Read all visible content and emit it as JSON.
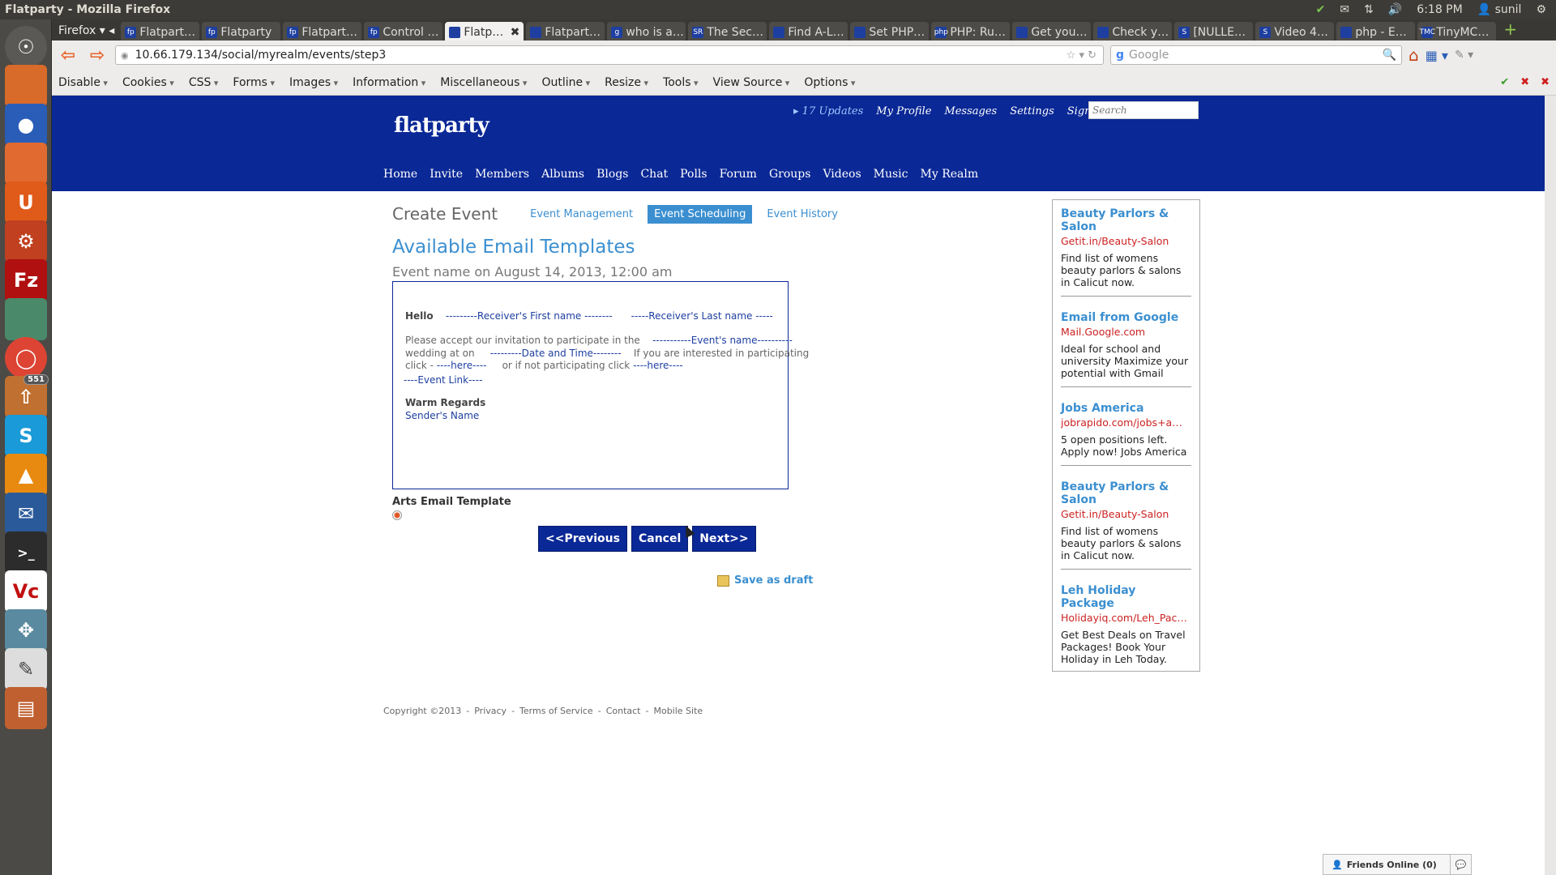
{
  "os": {
    "window_title": "Flatparty - Mozilla Firefox",
    "time": "6:18 PM",
    "user": "sunil",
    "launcher_badge": "551"
  },
  "browser": {
    "menu_label": "Firefox",
    "tabs": [
      {
        "label": "Flatpart…",
        "fav": "fp"
      },
      {
        "label": "Flatparty",
        "fav": "fp"
      },
      {
        "label": "Flatpart…",
        "fav": "fp"
      },
      {
        "label": "Control …",
        "fav": "fp"
      },
      {
        "label": "Flatp…",
        "fav": "",
        "active": true
      },
      {
        "label": "Flatpart…",
        "fav": ""
      },
      {
        "label": "who is a…",
        "fav": "g"
      },
      {
        "label": "The Sec…",
        "fav": "SR"
      },
      {
        "label": "Find A-L…",
        "fav": ""
      },
      {
        "label": "Set PHP…",
        "fav": ""
      },
      {
        "label": "PHP: Ru…",
        "fav": "php"
      },
      {
        "label": "Get you…",
        "fav": ""
      },
      {
        "label": "Check y…",
        "fav": ""
      },
      {
        "label": "[NULLE…",
        "fav": "S"
      },
      {
        "label": "Video 4…",
        "fav": "S"
      },
      {
        "label": "php - E…",
        "fav": ""
      },
      {
        "label": "TinyMC…",
        "fav": "TMC"
      }
    ],
    "url": "10.66.179.134/social/myrealm/events/step3",
    "search_placeholder": "Google",
    "devbar": [
      "Disable",
      "Cookies",
      "CSS",
      "Forms",
      "Images",
      "Information",
      "Miscellaneous",
      "Outline",
      "Resize",
      "Tools",
      "View Source",
      "Options"
    ]
  },
  "site": {
    "logo": "flatparty",
    "top_links": {
      "updates": "17 Updates",
      "profile": "My Profile",
      "messages": "Messages",
      "settings": "Settings",
      "signout": "Sign Out"
    },
    "search_placeholder": "Search",
    "nav": [
      "Home",
      "Invite",
      "Members",
      "Albums",
      "Blogs",
      "Chat",
      "Polls",
      "Forum",
      "Groups",
      "Videos",
      "Music",
      "My Realm"
    ]
  },
  "main": {
    "title": "Create Event",
    "subtabs": [
      "Event Management",
      "Event Scheduling",
      "Event History"
    ],
    "active_subtab": "Event Scheduling",
    "heading": "Available Email Templates",
    "event_line": "Event name on August 14, 2013, 12:00 am",
    "template": {
      "hello": "Hello",
      "receiver_first": "---------Receiver's First name --------",
      "receiver_last": "-----Receiver's Last name -----",
      "invite_text": "Please accept our invitation to participate in the",
      "event_name": "-----------Event's name----------",
      "wedding": "wedding at on",
      "date_time": "---------Date and Time--------",
      "interested": "If you are interested in participating",
      "click": "click -",
      "here1": "----here----",
      "not_participating": "or if not participating click",
      "here2": "----here----",
      "event_link": "----Event Link----",
      "regards": "Warm Regards",
      "sender": "Sender's Name"
    },
    "template_name": "Arts Email Template",
    "buttons": {
      "previous": "<<Previous",
      "cancel": "Cancel",
      "next": "Next>>"
    },
    "save_draft": "Save as draft"
  },
  "footer": {
    "copyright": "Copyright ©2013",
    "links": [
      "Privacy",
      "Terms of Service",
      "Contact",
      "Mobile Site"
    ]
  },
  "ads": [
    {
      "title": "Beauty Parlors & Salon",
      "url": "Getit.in/Beauty-Salon",
      "desc": "Find list of womens beauty parlors & salons in Calicut now."
    },
    {
      "title": "Email from Google",
      "url": "Mail.Google.com",
      "desc": "Ideal for school and university Maximize your potential with Gmail"
    },
    {
      "title": "Jobs America",
      "url": "jobrapido.com/jobs+am…",
      "desc": "5 open positions left. Apply now! Jobs America"
    },
    {
      "title": "Beauty Parlors & Salon",
      "url": "Getit.in/Beauty-Salon",
      "desc": "Find list of womens beauty parlors & salons in Calicut now."
    },
    {
      "title": "Leh Holiday Package",
      "url": "Holidayiq.com/Leh_Pac…",
      "desc": "Get Best Deals on Travel Packages! Book Your Holiday in Leh Today."
    }
  ],
  "friends_online": "Friends Online (0)",
  "colors": {
    "brand_blue": "#0a2896",
    "link_blue": "#3b8fd0",
    "ad_url_red": "#cc2222"
  }
}
